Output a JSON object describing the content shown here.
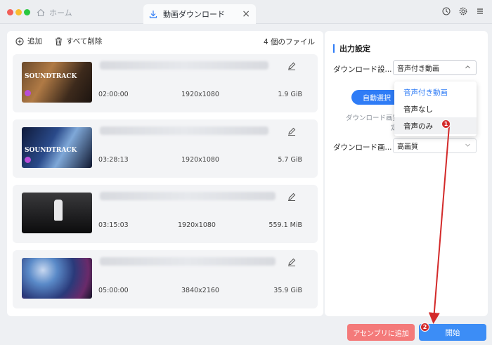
{
  "window": {
    "tabs": [
      {
        "label": "ホーム",
        "icon": "home-icon",
        "active": false
      },
      {
        "label": "動画ダウンロード",
        "icon": "download-icon",
        "active": true
      }
    ],
    "title_icons": [
      "history-icon",
      "gear-icon",
      "menu-icon"
    ]
  },
  "toolbar": {
    "add_label": "追加",
    "delete_all_label": "すべて削除",
    "file_count": "4 個のファイル"
  },
  "videos": [
    {
      "thumbnail_text": "SOUNDTRACK",
      "duration": "02:00:00",
      "resolution": "1920x1080",
      "size": "1.9 GiB"
    },
    {
      "thumbnail_text": "SOUNDTRACK",
      "duration": "03:28:13",
      "resolution": "1920x1080",
      "size": "5.7 GiB"
    },
    {
      "thumbnail_text": "",
      "duration": "03:15:03",
      "resolution": "1920x1080",
      "size": "559.1 MiB"
    },
    {
      "thumbnail_text": "",
      "duration": "05:00:00",
      "resolution": "3840x2160",
      "size": "35.9 GiB"
    }
  ],
  "output_settings": {
    "title": "出力設定",
    "download_setting_label": "ダウンロード設...",
    "download_setting_value": "音声付き動画",
    "auto_select_label": "自動選択",
    "hint_line1": "ダウンロード画質",
    "hint_line2": "定",
    "quality_label": "ダウンロード画...",
    "quality_value": "高画質",
    "dropdown_options": [
      "音声付き動画",
      "音声なし",
      "音声のみ"
    ]
  },
  "annotations": {
    "marker1": "1",
    "marker2": "2"
  },
  "buttons": {
    "add_to_assembly": "アセンブリに追加",
    "start": "開始"
  },
  "colors": {
    "accent": "#2f7cf6",
    "annotation": "#d32a2a",
    "add_button": "#f47a7a"
  }
}
